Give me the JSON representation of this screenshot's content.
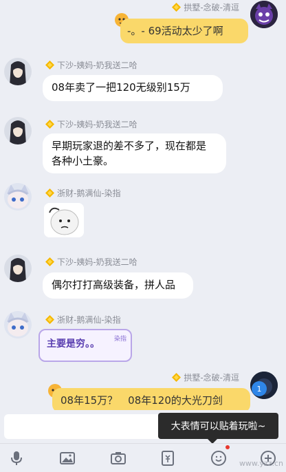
{
  "messages": [
    {
      "sender": "拱墅-念破-清逗",
      "text": "-。- 69活动太少了啊",
      "side": "right"
    },
    {
      "sender": "下沙-姨妈-奶我送二哈",
      "text": "08年卖了一把120无级别15万",
      "side": "left"
    },
    {
      "sender": "下沙-姨妈-奶我送二哈",
      "text_line1": "早期玩家退的差不多了，现在都是",
      "text_line2": "各种小土豪。",
      "side": "left"
    },
    {
      "sender": "浙财-鹅满仙-染指",
      "sticker": "sad-face-sticker",
      "side": "left"
    },
    {
      "sender": "下沙-姨妈-奶我送二哈",
      "text": "偶尔打打高级装备，拼人品",
      "side": "left"
    },
    {
      "sender": "浙财-鹅满仙-染指",
      "text": "主要是穷。。",
      "tag": "染指",
      "side": "left"
    },
    {
      "sender": "拱墅-念破-清逗",
      "text": "08年15万？　08年120的大光刀剑",
      "side": "right",
      "badge": "1"
    }
  ],
  "tooltip": "大表情可以贴着玩啦~",
  "input": {
    "value": ""
  },
  "toolbar": [
    "microphone-icon",
    "image-icon",
    "camera-icon",
    "red-packet-icon",
    "emoji-icon",
    "plus-icon"
  ],
  "watermark": "www.yzz.cn",
  "colors": {
    "accent_yellow": "#fad86a",
    "background": "#eceef4"
  }
}
